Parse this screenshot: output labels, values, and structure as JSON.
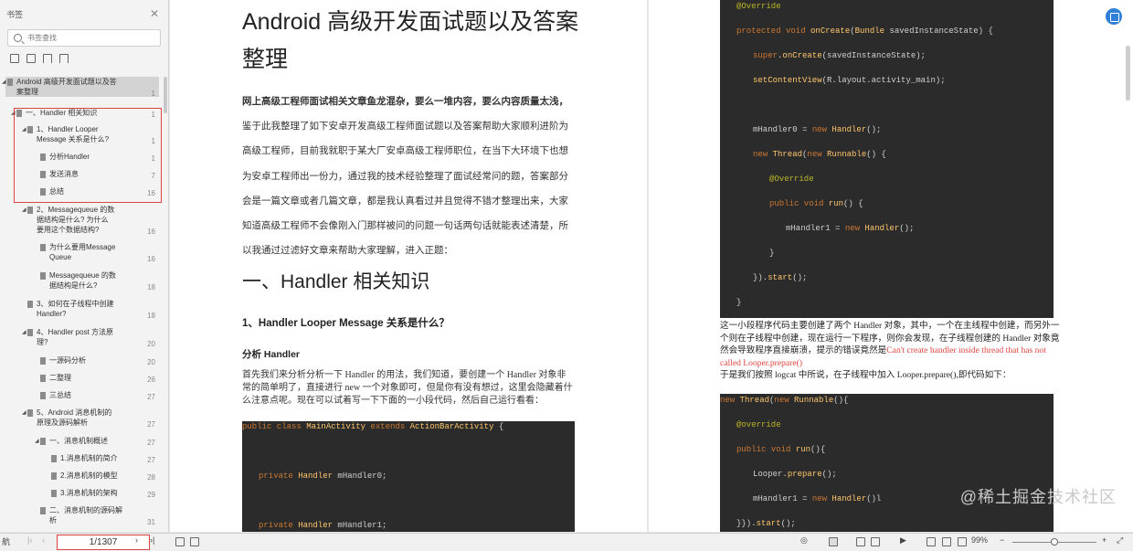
{
  "sidebar": {
    "title": "书签",
    "close": "✕",
    "search_placeholder": "书签查找",
    "items": [
      {
        "label": "Android 高级开发面试题以及答案整理",
        "page": "1",
        "level": 0,
        "selected": true
      },
      {
        "label": "一、Handler 相关知识",
        "page": "1",
        "level": 1
      },
      {
        "label": "1、Handler Looper Message 关系是什么?",
        "page": "1",
        "level": 2
      },
      {
        "label": "分析Handler",
        "page": "1",
        "level": 3
      },
      {
        "label": "发送消息",
        "page": "7",
        "level": 3
      },
      {
        "label": "总结",
        "page": "16",
        "level": 3
      },
      {
        "label": "2、Messagequeue 的数据结构是什么? 为什么要用这个数据结构?",
        "page": "16",
        "level": 2
      },
      {
        "label": "为什么要用Message Queue",
        "page": "16",
        "level": 3
      },
      {
        "label": "Messagequeue 的数据结构是什么?",
        "page": "18",
        "level": 3
      },
      {
        "label": "3、如何在子线程中创建Handler?",
        "page": "18",
        "level": 2
      },
      {
        "label": "4、Handler post 方法原理?",
        "page": "20",
        "level": 2
      },
      {
        "label": "一源码分析",
        "page": "20",
        "level": 3
      },
      {
        "label": "二整理",
        "page": "26",
        "level": 3
      },
      {
        "label": "三总结",
        "page": "27",
        "level": 3
      },
      {
        "label": "5、Android 消息机制的原理及源码解析",
        "page": "27",
        "level": 2
      },
      {
        "label": "一、消息机制概述",
        "page": "27",
        "level": 3
      },
      {
        "label": "1.消息机制的简介",
        "page": "27",
        "level": 4
      },
      {
        "label": "2.消息机制的模型",
        "page": "28",
        "level": 4
      },
      {
        "label": "3.消息机制的架构",
        "page": "29",
        "level": 4
      },
      {
        "label": "二、消息机制的源码解析",
        "page": "31",
        "level": 3
      }
    ]
  },
  "document": {
    "title": "Android 高级开发面试题以及答案整理",
    "intro_bold": "网上高级工程师面试相关文章鱼龙混杂，要么一堆内容，要么内容质量太浅，",
    "intro": "鉴于此我整理了如下安卓开发高级工程师面试题以及答案帮助大家顺利进阶为高级工程师，目前我就职于某大厂安卓高级工程师职位，在当下大环境下也想为安卓工程师出一份力，通过我的技术经验整理了面试经常问的题，答案部分会是一篇文章或者几篇文章，都是我认真看过并且觉得不错才整理出来，大家知道高级工程师不会像刚入门那样被问的问题一句话两句话就能表述清楚，所以我通过过滤好文章来帮助大家理解，进入正题：",
    "section": "一、Handler 相关知识",
    "question": "1、Handler Looper Message 关系是什么？",
    "subsection": "分析 Handler",
    "body": "首先我们来分析分析一下 Handler 的用法，我们知道，要创建一个 Handler 对象非常的简单明了，直接进行 new 一个对象即可，但是你有没有想过，这里会隐藏着什么注意点呢。现在可以试着写一下下面的一小段代码，然后自己运行看看：",
    "p2_text1": "这一小段程序代码主要创建了两个 Handler 对象，其中，一个在主线程中创建，而另外一个则在子线程中创建，现在运行一下程序，则你会发现，在子线程创建的 Handler 对象竟然会导致程序直接崩溃，提示的错误竟然是",
    "p2_error": "Can't create handler inside thread that has not called Looper.prepare()",
    "p2_text2": "于是我们按照 logcat 中所说，在子线程中加入 Looper.prepare(),即代码如下："
  },
  "watermark": "@稀土掘金技术社区",
  "statusbar": {
    "left_label": "航",
    "page_indicator": "1/1307",
    "zoom": "99%"
  }
}
